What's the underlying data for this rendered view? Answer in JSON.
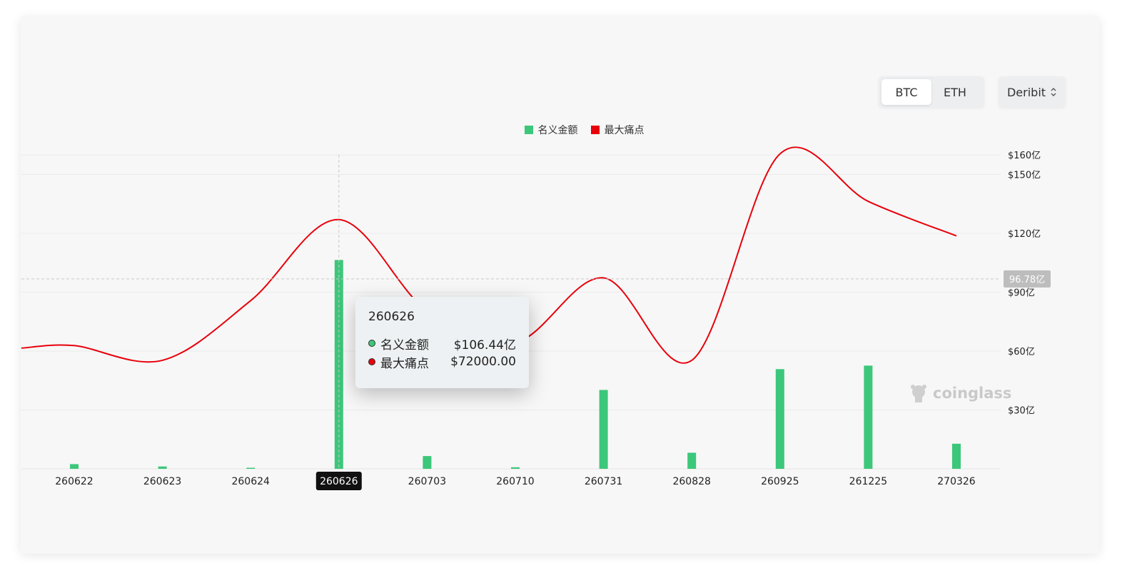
{
  "controls": {
    "coins": [
      {
        "label": "BTC",
        "active": true
      },
      {
        "label": "ETH",
        "active": false
      }
    ],
    "exchange": "Deribit"
  },
  "legend": [
    {
      "label": "名义金额",
      "color": "#3cc77a"
    },
    {
      "label": "最大痛点",
      "color": "#e8000b"
    }
  ],
  "chart_data": {
    "type": "bar",
    "categories": [
      "260622",
      "260623",
      "260624",
      "260626",
      "260703",
      "260710",
      "260731",
      "260828",
      "260925",
      "261225",
      "270326"
    ],
    "series": [
      {
        "name": "名义金额",
        "type": "bar",
        "color": "#3cc77a",
        "values": [
          2.4,
          1.2,
          0.2,
          106.44,
          6.5,
          0.8,
          40.2,
          8.2,
          50.8,
          52.6,
          12.8
        ]
      },
      {
        "name": "最大痛点",
        "type": "line",
        "color": "#e8000b",
        "values": [
          62.8,
          55.3,
          85.7,
          72000.0,
          80.5,
          64.4,
          97.3,
          55.3,
          160.5,
          136.3,
          118.7
        ]
      }
    ],
    "yaxis_right_ticks": [
      {
        "value": 30,
        "label": "$30亿"
      },
      {
        "value": 60,
        "label": "$60亿"
      },
      {
        "value": 90,
        "label": "$90亿"
      },
      {
        "value": 120,
        "label": "$120亿"
      },
      {
        "value": 150,
        "label": "$150亿"
      },
      {
        "value": 160,
        "label": "$160亿"
      }
    ],
    "ylim": [
      0,
      160
    ],
    "crosshair": {
      "category": "260626",
      "y_label": "96.78亿"
    },
    "tooltip": {
      "title": "260626",
      "rows": [
        {
          "label": "名义金额",
          "value": "$106.44亿",
          "color": "#3cc77a"
        },
        {
          "label": "最大痛点",
          "value": "$72000.00",
          "color": "#e8000b"
        }
      ]
    }
  },
  "watermark": "coinglass"
}
